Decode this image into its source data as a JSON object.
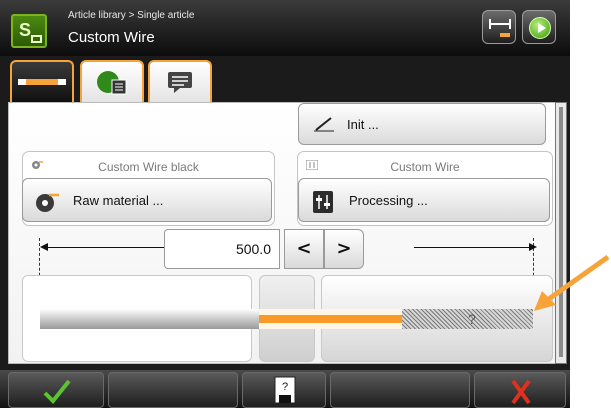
{
  "header": {
    "breadcrumb": "Article library > Single article",
    "title": "Custom Wire"
  },
  "tabs": [
    {
      "icon": "wire-segment-icon",
      "active": true
    },
    {
      "icon": "round-gear-icon",
      "active": false
    },
    {
      "icon": "comment-icon",
      "active": false
    }
  ],
  "actions": {
    "init_label": "Init ..."
  },
  "raw_material": {
    "group_title": "Custom Wire black",
    "button_label": "Raw material ..."
  },
  "processing": {
    "group_title": "Custom Wire",
    "button_label": "Processing ..."
  },
  "length": {
    "value": "500.0",
    "prev_symbol": "<",
    "next_symbol": ">"
  },
  "wire": {
    "unknown_marker": "?"
  },
  "colors": {
    "accent": "#f7a33a",
    "wire_orange": "#f79a28",
    "ok_green": "#5cc233",
    "cancel_red": "#e0301e",
    "brand_green": "#4c8a10"
  }
}
